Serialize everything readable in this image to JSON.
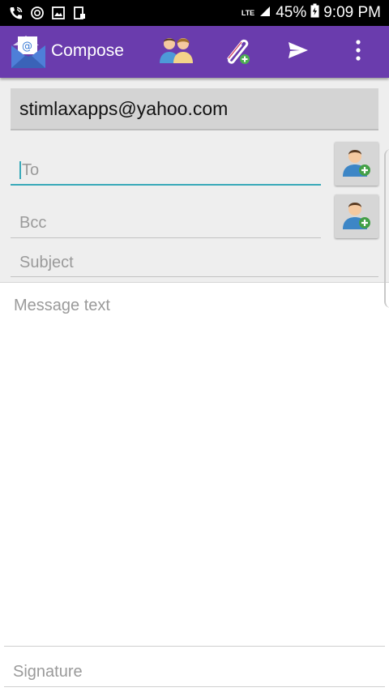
{
  "status_bar": {
    "network": "LTE",
    "battery": "45%",
    "time": "9:09 PM",
    "left_icons": [
      "wifi-call-icon",
      "sync-icon",
      "gallery-icon",
      "clipboard-icon"
    ]
  },
  "toolbar": {
    "title": "Compose",
    "background": "#6a3cad",
    "actions": [
      "contacts-icon",
      "attach-icon",
      "send-icon",
      "overflow-menu-icon"
    ]
  },
  "compose": {
    "from_account": "stimlaxapps@yahoo.com",
    "to_placeholder": "To",
    "bcc_placeholder": "Bcc",
    "subject_placeholder": "Subject",
    "message_placeholder": "Message text",
    "signature_placeholder": "Signature",
    "accent": "#39a9b9"
  }
}
